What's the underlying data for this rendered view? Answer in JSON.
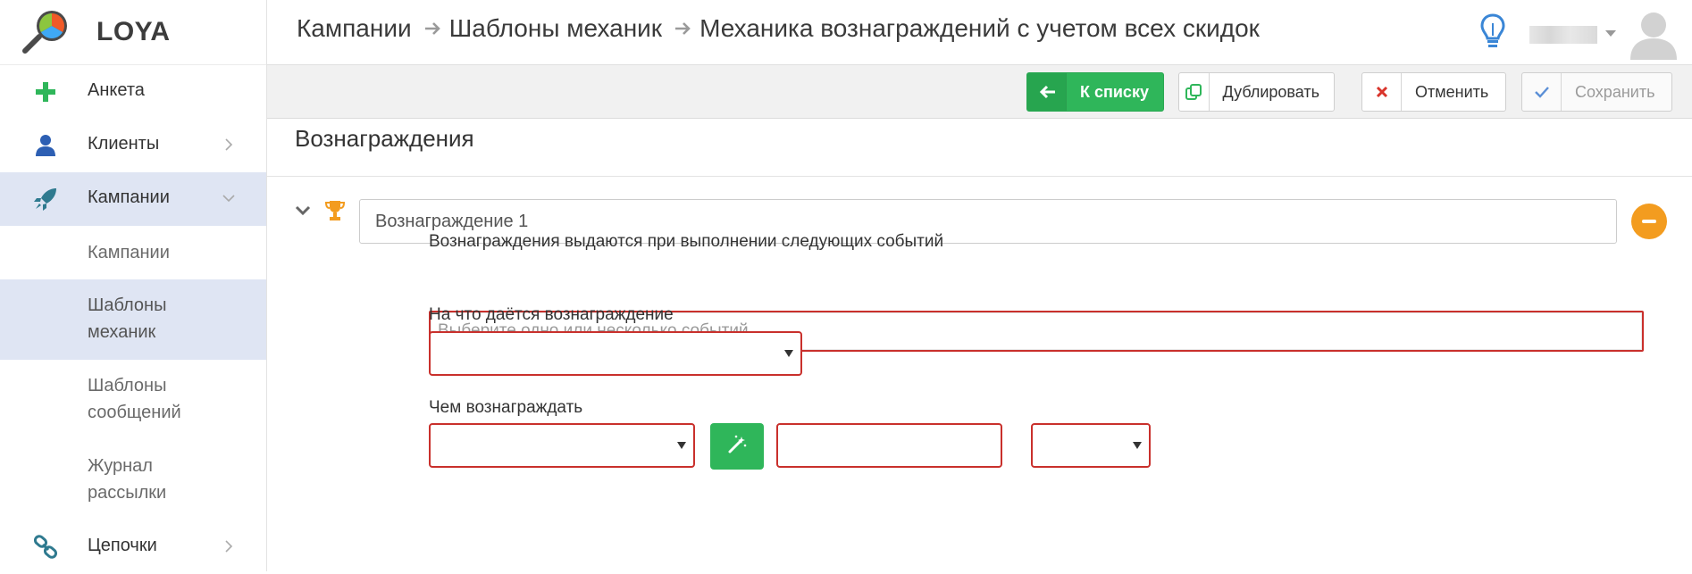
{
  "app": {
    "name": "LOYA"
  },
  "sidebar": {
    "items": [
      {
        "label": "Анкета",
        "icon": "plus-icon"
      },
      {
        "label": "Клиенты",
        "icon": "user-icon"
      },
      {
        "label": "Кампании",
        "icon": "rocket-icon",
        "active": true
      },
      {
        "label": "Кампании",
        "sub": true
      },
      {
        "label": "Шаблоны механик",
        "sub": true,
        "active": true
      },
      {
        "label": "Шаблоны сообщений",
        "sub": true
      },
      {
        "label": "Журнал рассылки",
        "sub": true
      },
      {
        "label": "Цепочки",
        "icon": "link-icon"
      }
    ]
  },
  "header": {
    "breadcrumb": [
      "Кампании",
      "Шаблоны механик",
      "Механика вознаграждений с учетом всех скидок"
    ]
  },
  "toolbar": {
    "to_list": "К списку",
    "duplicate": "Дублировать",
    "cancel": "Отменить",
    "save": "Сохранить"
  },
  "main": {
    "section_title": "Вознаграждения",
    "reward_name": "Вознаграждение 1",
    "events_label": "Вознаграждения выдаются при выполнении следующих событий",
    "events_placeholder": "Выберите одно или несколько событий",
    "target_label": "На что даётся вознаграждение",
    "reward_with_label": "Чем вознаграждать"
  },
  "colors": {
    "accent_green": "#2fb65a",
    "active_nav": "#dfe5f3",
    "error_border": "#c9302c",
    "remove_orange": "#f39c1f"
  }
}
